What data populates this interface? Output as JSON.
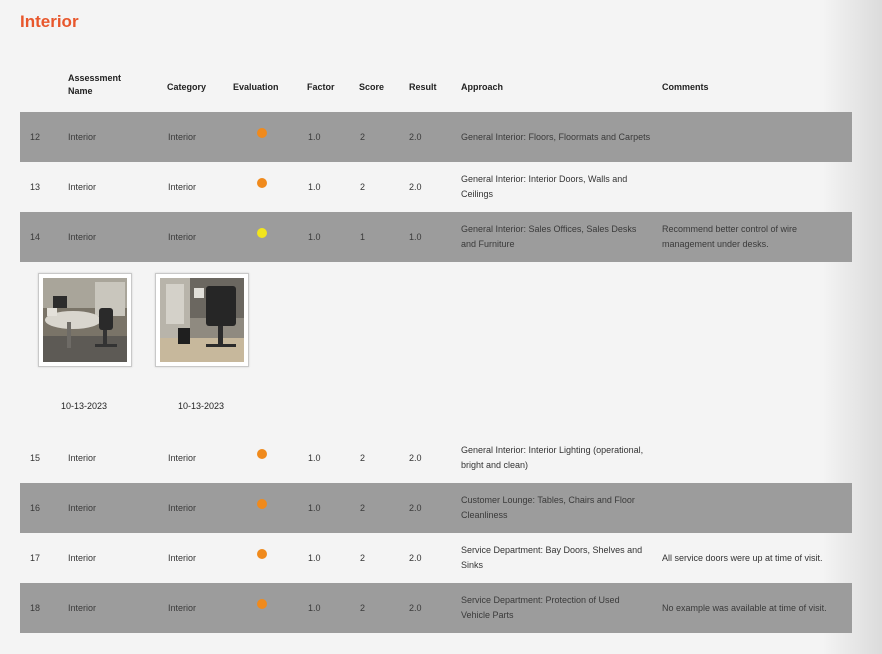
{
  "section": {
    "title": "Interior"
  },
  "table": {
    "headers": {
      "name": "Assessment Name",
      "category": "Category",
      "evaluation": "Evaluation",
      "factor": "Factor",
      "score": "Score",
      "result": "Result",
      "approach": "Approach",
      "comments": "Comments"
    },
    "rows": [
      {
        "id": "12",
        "name": "Interior",
        "category": "Interior",
        "evaluation": "orange",
        "factor": "1.0",
        "score": "2",
        "result": "2.0",
        "approach": "General Interior: Floors, Floormats and Carpets",
        "comments": ""
      },
      {
        "id": "13",
        "name": "Interior",
        "category": "Interior",
        "evaluation": "orange",
        "factor": "1.0",
        "score": "2",
        "result": "2.0",
        "approach": "General Interior: Interior Doors, Walls and Ceilings",
        "comments": ""
      },
      {
        "id": "14",
        "name": "Interior",
        "category": "Interior",
        "evaluation": "yellow",
        "factor": "1.0",
        "score": "1",
        "result": "1.0",
        "approach": "General Interior: Sales Offices, Sales Desks and Furniture",
        "comments": "Recommend better control of wire management under desks."
      },
      {
        "id": "15",
        "name": "Interior",
        "category": "Interior",
        "evaluation": "orange",
        "factor": "1.0",
        "score": "2",
        "result": "2.0",
        "approach": "General Interior: Interior Lighting (operational, bright and clean)",
        "comments": ""
      },
      {
        "id": "16",
        "name": "Interior",
        "category": "Interior",
        "evaluation": "orange",
        "factor": "1.0",
        "score": "2",
        "result": "2.0",
        "approach": "Customer Lounge: Tables, Chairs and Floor Cleanliness",
        "comments": ""
      },
      {
        "id": "17",
        "name": "Interior",
        "category": "Interior",
        "evaluation": "orange",
        "factor": "1.0",
        "score": "2",
        "result": "2.0",
        "approach": "Service Department: Bay Doors, Shelves and Sinks",
        "comments": "All service doors were up at time of visit."
      },
      {
        "id": "18",
        "name": "Interior",
        "category": "Interior",
        "evaluation": "orange",
        "factor": "1.0",
        "score": "2",
        "result": "2.0",
        "approach": "Service Department: Protection of Used Vehicle Parts",
        "comments": "No example was available at time of visit."
      }
    ]
  },
  "photos": [
    {
      "date": "10-13-2023"
    },
    {
      "date": "10-13-2023"
    }
  ],
  "colors": {
    "orange": "#f08a1c",
    "yellow": "#f2e51c",
    "title": "#e8572c",
    "shaded_row": "#9c9c9c"
  }
}
